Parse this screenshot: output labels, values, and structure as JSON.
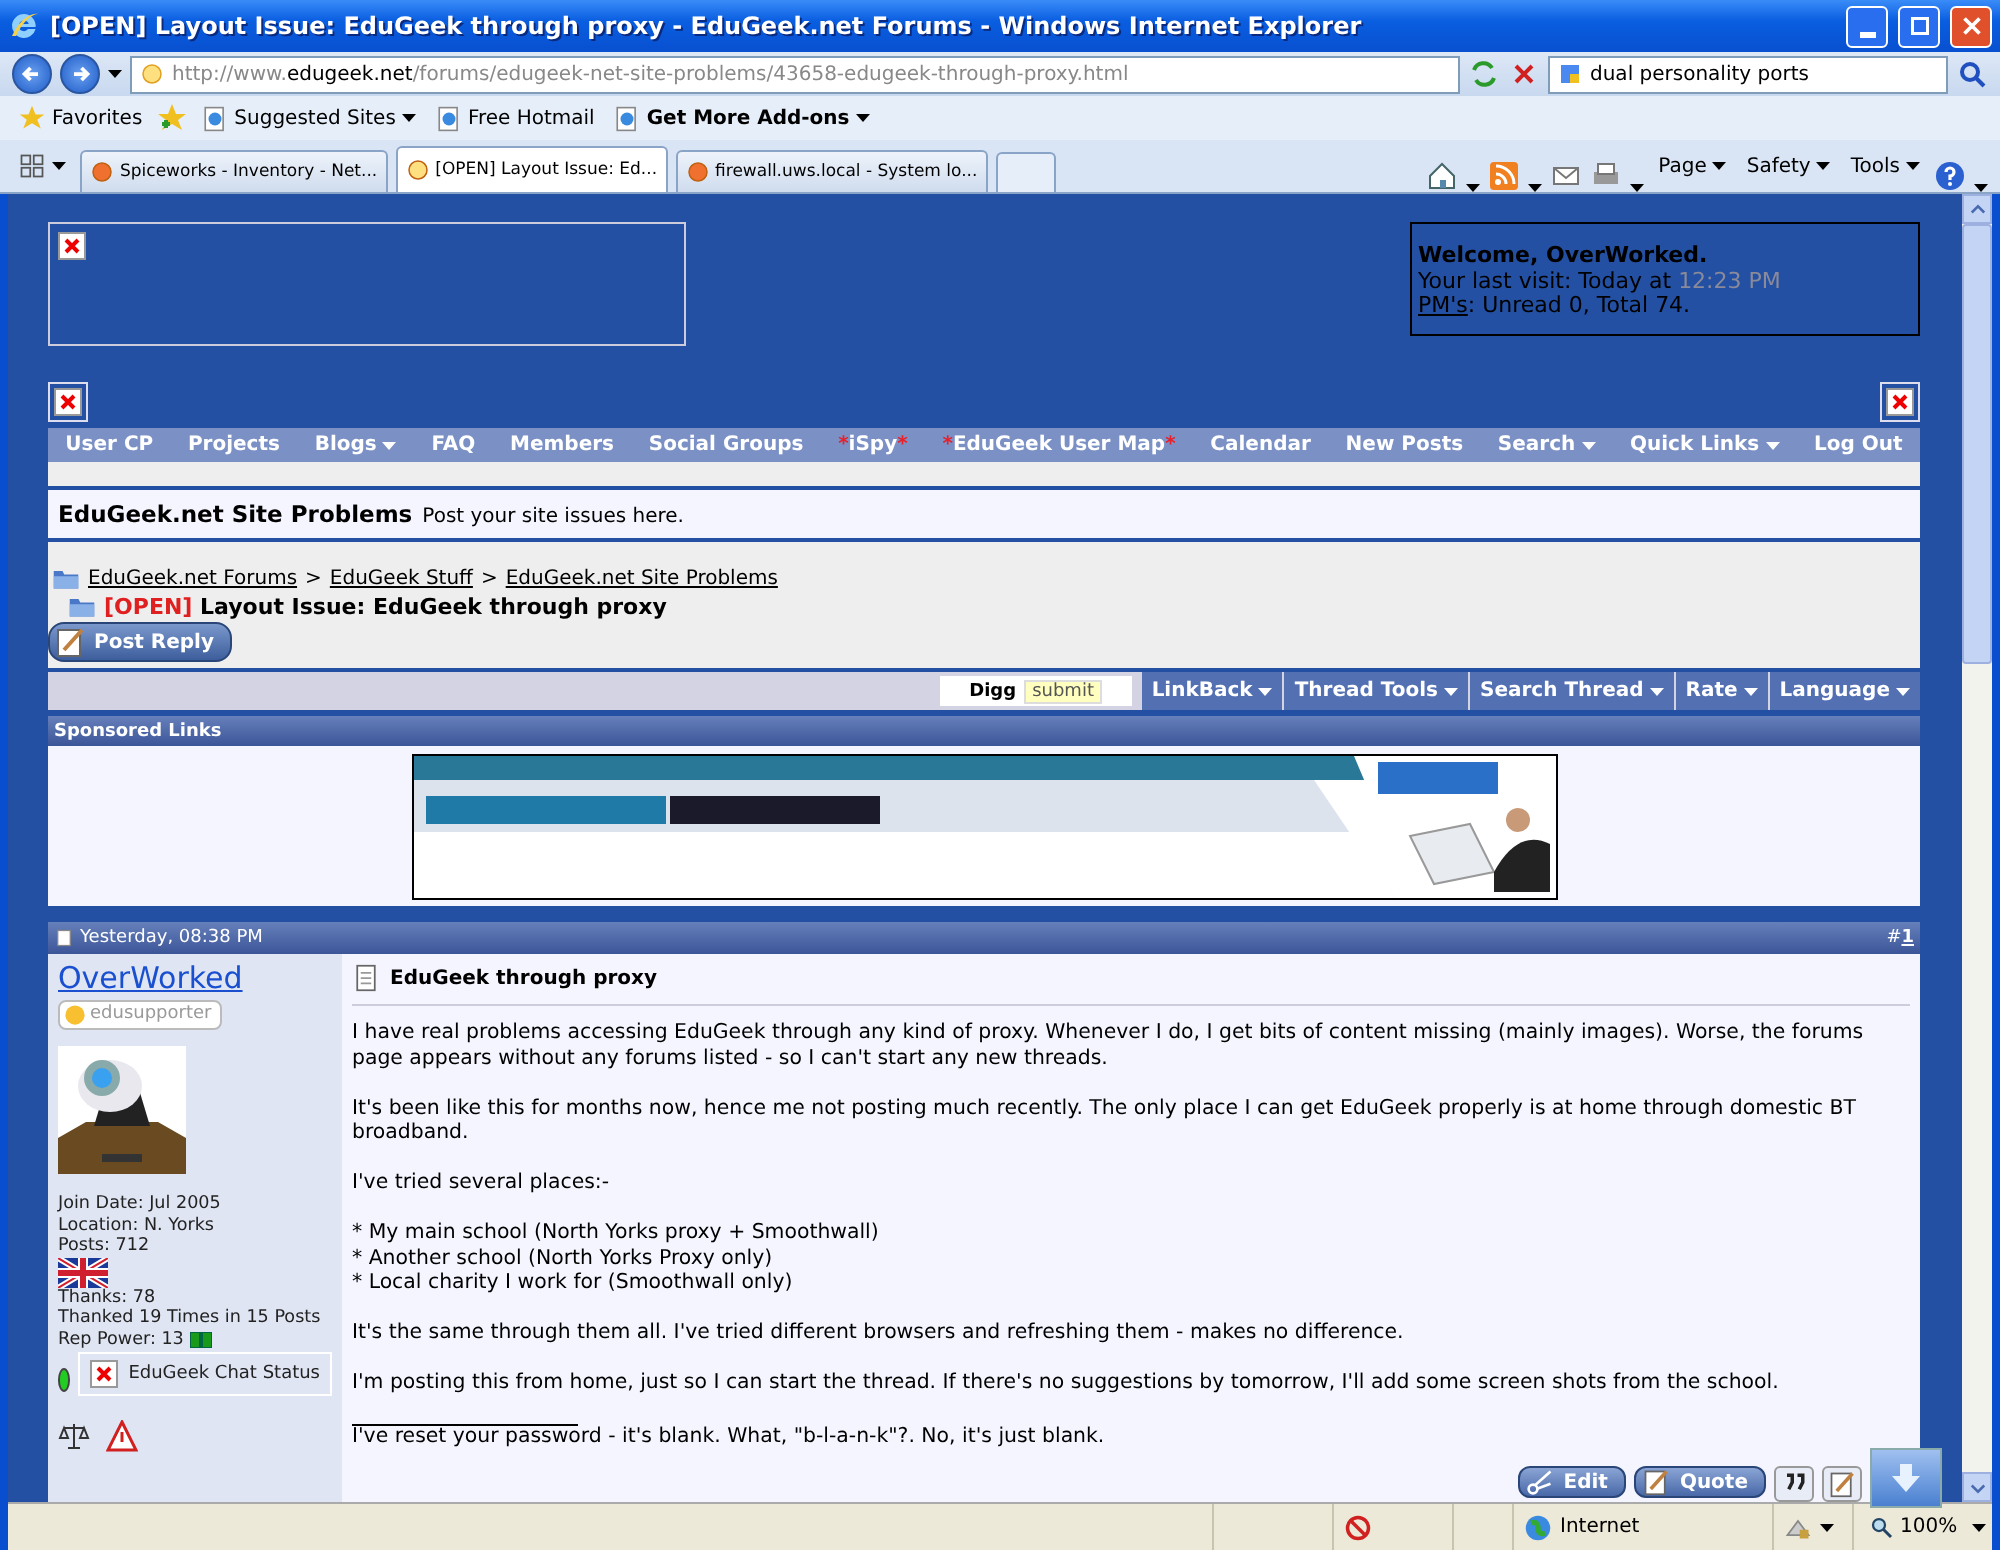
{
  "window": {
    "title": "[OPEN] Layout Issue: EduGeek through proxy - EduGeek.net Forums - Windows Internet Explorer"
  },
  "address_bar": {
    "url": [
      {
        "text": "http://www.",
        "highlight": false
      },
      {
        "text": "edugeek.net",
        "highlight": true
      },
      {
        "text": "/forums/edugeek-net-site-problems/43658-edugeek-through-proxy.html",
        "highlight": false
      }
    ]
  },
  "search": {
    "value": "dual personality ports"
  },
  "favorites_bar": {
    "label": "Favorites",
    "links": [
      {
        "label": "Suggested Sites",
        "dropdown": true,
        "bold": false
      },
      {
        "label": "Free Hotmail",
        "dropdown": false,
        "bold": false
      },
      {
        "label": "Get More Add-ons",
        "dropdown": true,
        "bold": true
      }
    ]
  },
  "tabs": [
    {
      "label": "Spiceworks - Inventory - Net...",
      "selected": false
    },
    {
      "label": "[OPEN] Layout Issue: Ed...",
      "selected": true
    },
    {
      "label": "firewall.uws.local - System lo...",
      "selected": false
    }
  ],
  "command_bar": [
    {
      "label": "Page"
    },
    {
      "label": "Safety"
    },
    {
      "label": "Tools"
    }
  ],
  "welcome": {
    "greeting": "Welcome, OverWorked.",
    "last_visit": "Your last visit: Today at",
    "last_visit_time": "12:23 PM",
    "pm_link": "PM's",
    "pm_text": ": Unread 0, Total 74."
  },
  "navbar": [
    {
      "label": "User CP",
      "dropdown": false
    },
    {
      "label": "Projects",
      "dropdown": false
    },
    {
      "label": "Blogs",
      "dropdown": true
    },
    {
      "label": "FAQ",
      "dropdown": false
    },
    {
      "label": "Members",
      "dropdown": false
    },
    {
      "label": "Social Groups",
      "dropdown": false
    },
    {
      "label": "iSpy",
      "prefix": "*",
      "suffix": "*",
      "dropdown": false
    },
    {
      "label": "EduGeek User Map",
      "prefix": "*",
      "suffix": "*",
      "dropdown": false
    },
    {
      "label": "Calendar",
      "dropdown": false
    },
    {
      "label": "New Posts",
      "dropdown": false
    },
    {
      "label": "Search",
      "dropdown": true
    },
    {
      "label": "Quick Links",
      "dropdown": true
    },
    {
      "label": "Log Out",
      "dropdown": false
    }
  ],
  "forum": {
    "title": "EduGeek.net Site Problems",
    "description": "Post your site issues here."
  },
  "breadcrumbs": [
    {
      "label": "EduGeek.net Forums"
    },
    {
      "separator": ">",
      "label": "EduGeek Stuff"
    },
    {
      "separator": ">",
      "label": "EduGeek.net Site Problems"
    }
  ],
  "thread": {
    "prefix": "[OPEN]",
    "title": "Layout Issue: EduGeek through proxy"
  },
  "post_reply_button": "Post Reply",
  "thread_tools": {
    "digg_label": "Digg",
    "digg_button": "submit",
    "menus": [
      {
        "label": "LinkBack"
      },
      {
        "label": "Thread Tools"
      },
      {
        "label": "Search Thread"
      },
      {
        "label": "Rate"
      },
      {
        "label": "Language"
      }
    ]
  },
  "sponsored": {
    "title": "Sponsored Links"
  },
  "post": {
    "date": "Yesterday, 08:38 PM",
    "number_prefix": "#",
    "number": "1",
    "user": {
      "name": "OverWorked",
      "rank": "edusupporter",
      "details": [
        "Join Date: Jul 2005",
        "Location: N. Yorks",
        "Posts: 712"
      ],
      "stats": [
        "Thanks: 78",
        "Thanked 19 Times in 15 Posts"
      ],
      "rep_power": "Rep Power: 13",
      "online": true,
      "chat_status": "EduGeek Chat Status"
    },
    "title": "EduGeek through proxy",
    "paragraphs": [
      [
        "I have real problems accessing EduGeek through any kind of proxy. Whenever I do, I get bits of content missing (mainly images). Worse, the forums page appears without any forums listed - so I can't start any new threads."
      ],
      [
        "It's been like this for months now, hence me not posting much recently. The only place I can get EduGeek properly is at home through domestic BT broadband."
      ],
      [
        "I've tried several places:-"
      ],
      [
        "* My main school (North Yorks proxy + Smoothwall)",
        "* Another school (North Yorks Proxy only)",
        "* Local charity I work for (Smoothwall only)"
      ],
      [
        "It's the same through them all. I've tried different browsers and refreshing them - makes no difference."
      ],
      [
        "I'm posting this from home, just so I can start the thread. If there's no suggestions by tomorrow, I'll add some screen shots from the school."
      ]
    ],
    "signature": "I've reset your password - it's blank. What, \"b-l-a-n-k\"?. No, it's just blank.",
    "buttons": [
      {
        "label": "Edit",
        "kind": "edit"
      },
      {
        "label": "Quote",
        "kind": "quote"
      }
    ]
  },
  "status_bar": {
    "zone": "Internet",
    "zoom": "100%"
  }
}
